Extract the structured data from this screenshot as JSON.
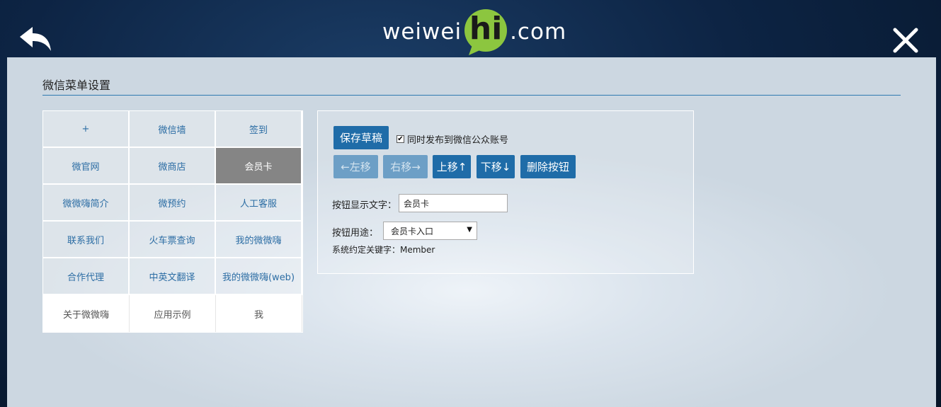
{
  "header": {
    "logo_left": "weiwei",
    "logo_mid": "hi",
    "logo_right": ".com"
  },
  "icons": {
    "back": "back-arrow-icon",
    "close": "close-icon"
  },
  "page": {
    "title": "微信菜单设置"
  },
  "menu": {
    "cells": [
      "+",
      "微信墙",
      "签到",
      "微官网",
      "微商店",
      "会员卡",
      "微微嗨简介",
      "微预约",
      "人工客服",
      "联系我们",
      "火车票查询",
      "我的微微嗨",
      "合作代理",
      "中英文翻译",
      "我的微微嗨(web)",
      "关于微微嗨",
      "应用示例",
      "我"
    ],
    "selected": "会员卡"
  },
  "editor": {
    "save_draft": "保存草稿",
    "sync_label": "同时发布到微信公众账号",
    "sync_checked": true,
    "move_left": "←左移",
    "move_right": "右移→",
    "move_up": "上移↑",
    "move_down": "下移↓",
    "delete": "删除按钮",
    "text_label": "按钮显示文字：",
    "text_value": "会员卡",
    "usage_label": "按钮用途：",
    "usage_value": "会员卡入口",
    "keyword_label": "系统约定关键字：Member"
  },
  "colors": {
    "accent": "#1f6ca8",
    "accent_disabled": "#6d9fc6",
    "link_text": "#2c6da4",
    "selected_cell": "#858585",
    "title_line": "#2f7ab0"
  }
}
